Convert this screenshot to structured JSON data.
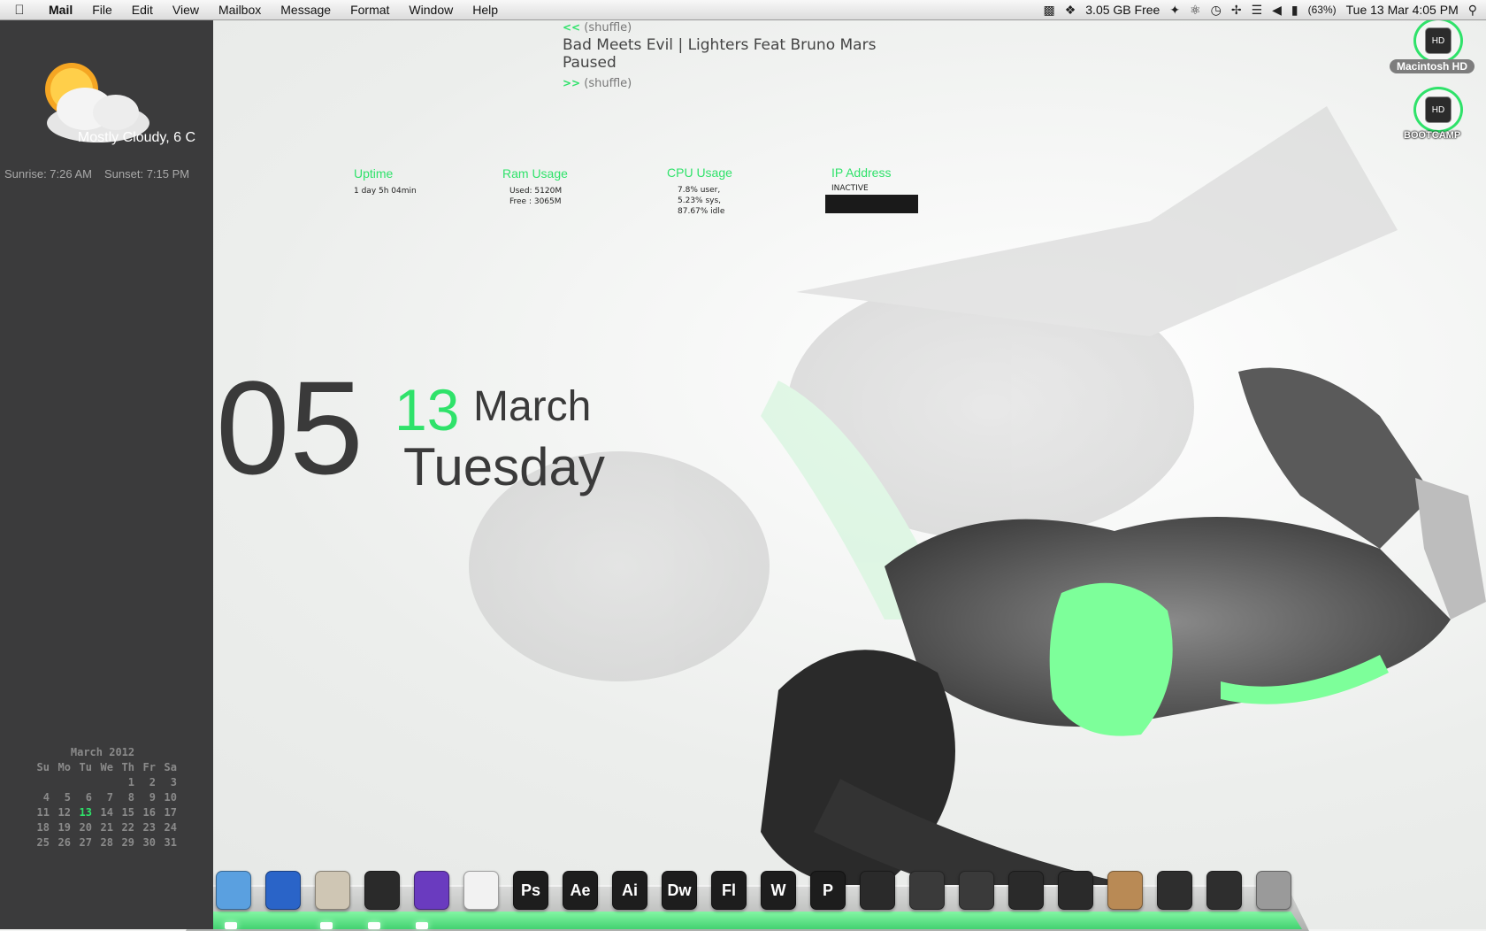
{
  "menubar": {
    "apple_icon": "apple-logo",
    "items": [
      "Mail",
      "File",
      "Edit",
      "View",
      "Mailbox",
      "Message",
      "Format",
      "Window",
      "Help"
    ],
    "status": {
      "disk_free": "3.05 GB Free",
      "battery": "(63%)",
      "datetime": "Tue 13 Mar  4:05 PM"
    }
  },
  "weather": {
    "condition": "Mostly Cloudy, 6 C",
    "sunrise": "Sunrise: 7:26 AM",
    "sunset": "Sunset: 7:15 PM"
  },
  "clock": {
    "hour": "4",
    "minute": "05",
    "day": "13",
    "month": "March",
    "weekday": "Tuesday"
  },
  "itunes": {
    "prev": "<<",
    "prev_label": "(shuffle)",
    "track": "Bad Meets Evil | Lighters Feat Bruno Mars",
    "state": "Paused",
    "next": ">>",
    "next_label": "(shuffle)"
  },
  "stats": {
    "uptime": {
      "title": "Uptime",
      "value": "1 day 5h 04min"
    },
    "ram": {
      "title": "Ram Usage",
      "used": "Used: 5120M",
      "free": "Free : 3065M"
    },
    "cpu": {
      "title": "CPU Usage",
      "user": "7.8% user,",
      "sys": "5.23% sys,",
      "idle": "87.67% idle"
    },
    "ip": {
      "title": "IP Address",
      "value": "INACTIVE"
    }
  },
  "drives": [
    {
      "icon_text": "HD",
      "label": "Macintosh HD"
    },
    {
      "icon_text": "HD",
      "label": "BOOTCAMP"
    }
  ],
  "calendar": {
    "title": "March 2012",
    "headers": [
      "Su",
      "Mo",
      "Tu",
      "We",
      "Th",
      "Fr",
      "Sa"
    ],
    "weeks": [
      [
        "",
        "",
        "",
        "",
        "1",
        "2",
        "3"
      ],
      [
        "4",
        "5",
        "6",
        "7",
        "8",
        "9",
        "10"
      ],
      [
        "11",
        "12",
        "13",
        "14",
        "15",
        "16",
        "17"
      ],
      [
        "18",
        "19",
        "20",
        "21",
        "22",
        "23",
        "24"
      ],
      [
        "25",
        "26",
        "27",
        "28",
        "29",
        "30",
        "31"
      ]
    ],
    "today": "13"
  },
  "dock": [
    {
      "name": "finder",
      "label": "",
      "bg": "#5aa0e0"
    },
    {
      "name": "app-store",
      "label": "",
      "bg": "#2a64c8"
    },
    {
      "name": "mail",
      "label": "",
      "bg": "#cfc6b4"
    },
    {
      "name": "chrome",
      "label": "",
      "bg": "#2a2a2a"
    },
    {
      "name": "podcast",
      "label": "",
      "bg": "#6a3bbf"
    },
    {
      "name": "acrobat",
      "label": "",
      "bg": "#f2f2f2"
    },
    {
      "name": "photoshop",
      "label": "Ps",
      "bg": "#1d1d1d"
    },
    {
      "name": "after-effects",
      "label": "Ae",
      "bg": "#1d1d1d"
    },
    {
      "name": "illustrator",
      "label": "Ai",
      "bg": "#1d1d1d"
    },
    {
      "name": "dreamweaver",
      "label": "Dw",
      "bg": "#1d1d1d"
    },
    {
      "name": "flash",
      "label": "Fl",
      "bg": "#1d1d1d"
    },
    {
      "name": "word",
      "label": "W",
      "bg": "#1d1d1d"
    },
    {
      "name": "powerpoint",
      "label": "P",
      "bg": "#1d1d1d"
    },
    {
      "name": "transmit",
      "label": "",
      "bg": "#2a2a2a"
    },
    {
      "name": "final-cut",
      "label": "",
      "bg": "#3a3a3a"
    },
    {
      "name": "imovie",
      "label": "",
      "bg": "#3a3a3a"
    },
    {
      "name": "keynote",
      "label": "",
      "bg": "#2a2a2a"
    },
    {
      "name": "network",
      "label": "",
      "bg": "#2a2a2a"
    },
    {
      "name": "archive",
      "label": "",
      "bg": "#b98a55"
    },
    {
      "name": "folder",
      "label": "",
      "bg": "#2e2e2e"
    },
    {
      "name": "downloads",
      "label": "",
      "bg": "#2e2e2e"
    },
    {
      "name": "trash",
      "label": "",
      "bg": "#9a9a9a"
    }
  ],
  "colors": {
    "accent": "#2fe26a",
    "sidebar": "#3b3b3c"
  }
}
